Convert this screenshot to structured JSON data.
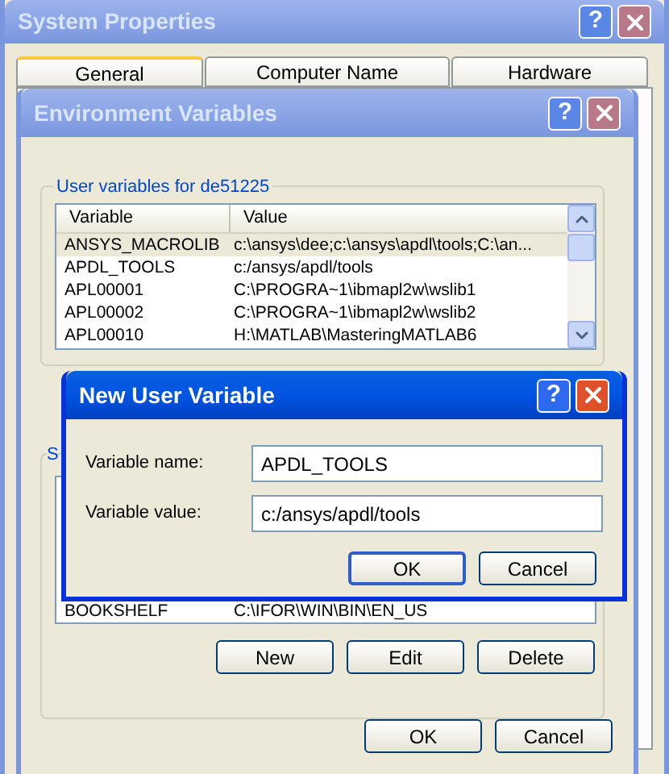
{
  "system_properties": {
    "title": "System Properties",
    "help": "?",
    "tabs": [
      {
        "label": "General",
        "selected": true
      },
      {
        "label": "Computer Name",
        "selected": false
      },
      {
        "label": "Hardware",
        "selected": false
      }
    ]
  },
  "environment_variables": {
    "title": "Environment Variables",
    "help": "?",
    "user_group": {
      "label": "User variables for de51225",
      "columns": [
        "Variable",
        "Value"
      ],
      "rows": [
        {
          "variable": "ANSYS_MACROLIB",
          "value": "c:\\ansys\\dee;c:\\ansys\\apdl\\tools;C:\\an...",
          "selected": true
        },
        {
          "variable": "APDL_TOOLS",
          "value": "c:/ansys/apdl/tools",
          "selected": false
        },
        {
          "variable": "APL00001",
          "value": "C:\\PROGRA~1\\ibmapl2w\\wslib1",
          "selected": false
        },
        {
          "variable": "APL00002",
          "value": "C:\\PROGRA~1\\ibmapl2w\\wslib2",
          "selected": false
        },
        {
          "variable": "APL00010",
          "value": "H:\\MATLAB\\MasteringMATLAB6",
          "selected": false
        }
      ]
    },
    "system_group": {
      "label": "S",
      "rows": [
        {
          "variable": "BOOKSHELF",
          "value": "C:\\IFOR\\WIN\\BIN\\EN_US",
          "selected": false
        }
      ],
      "buttons": [
        "New",
        "Edit",
        "Delete"
      ]
    },
    "buttons": [
      "OK",
      "Cancel"
    ]
  },
  "new_user_variable": {
    "title": "New User Variable",
    "help": "?",
    "fields": [
      {
        "label": "Variable name:",
        "value": "APDL_TOOLS"
      },
      {
        "label": "Variable value:",
        "value": "c:/ansys/apdl/tools"
      }
    ],
    "buttons": [
      {
        "label": "OK",
        "default": true
      },
      {
        "label": "Cancel",
        "default": false
      }
    ]
  }
}
